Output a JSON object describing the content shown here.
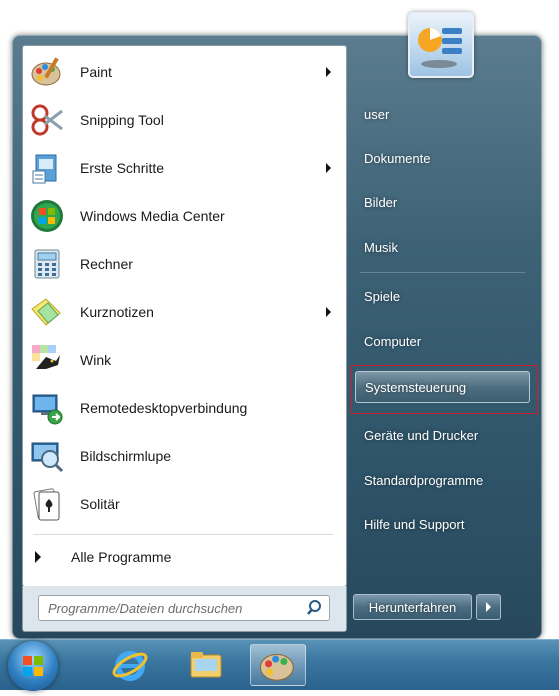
{
  "programs": [
    {
      "label": "Paint",
      "icon": "paint-palette-icon",
      "submenu": true
    },
    {
      "label": "Snipping Tool",
      "icon": "scissors-icon",
      "submenu": false
    },
    {
      "label": "Erste Schritte",
      "icon": "getting-started-icon",
      "submenu": true
    },
    {
      "label": "Windows Media Center",
      "icon": "windows-logo-icon",
      "submenu": false
    },
    {
      "label": "Rechner",
      "icon": "calculator-icon",
      "submenu": false
    },
    {
      "label": "Kurznotizen",
      "icon": "sticky-notes-icon",
      "submenu": true
    },
    {
      "label": "Wink",
      "icon": "wink-bird-icon",
      "submenu": false
    },
    {
      "label": "Remotedesktopverbindung",
      "icon": "remote-desktop-icon",
      "submenu": false
    },
    {
      "label": "Bildschirmlupe",
      "icon": "magnifier-icon",
      "submenu": false
    },
    {
      "label": "Solitär",
      "icon": "cards-icon",
      "submenu": false
    }
  ],
  "all_programs_label": "Alle Programme",
  "search": {
    "placeholder": "Programme/Dateien durchsuchen"
  },
  "right_items": [
    {
      "label": "user"
    },
    {
      "label": "Dokumente"
    },
    {
      "label": "Bilder"
    },
    {
      "label": "Musik"
    },
    {
      "label": "Spiele"
    },
    {
      "label": "Computer"
    },
    {
      "label": "Systemsteuerung",
      "selected": true
    },
    {
      "label": "Geräte und Drucker"
    },
    {
      "label": "Standardprogramme"
    },
    {
      "label": "Hilfe und Support"
    }
  ],
  "shutdown_label": "Herunterfahren",
  "colors": {
    "highlight_border": "#cc1f2e",
    "menu_bg": "#3d6276"
  },
  "taskbar": {
    "pinned": [
      "start-orb",
      "internet-explorer-icon",
      "explorer-folder-icon",
      "paint-palette-icon"
    ]
  }
}
